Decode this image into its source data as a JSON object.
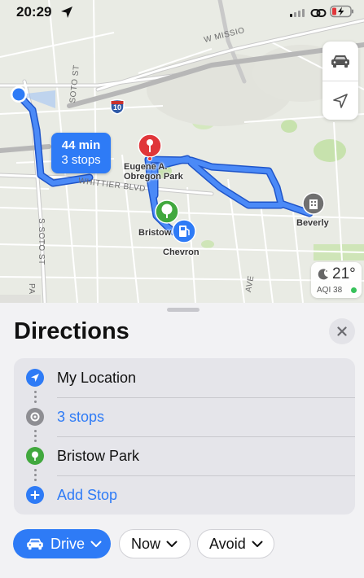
{
  "status_bar": {
    "time": "20:29"
  },
  "map": {
    "route_bubble": {
      "duration": "44 min",
      "stops": "3 stops"
    },
    "street_labels": {
      "w_mission": "W MISSIO",
      "soto_st_top": "SOTO ST",
      "whittier_blvd": "WHITTIER BLVD",
      "s_soto_st": "S SOTO ST",
      "pas": "PA",
      "ave": "AVE"
    },
    "highway_shield": "10",
    "places": {
      "park_name_line1": "Eugene A.",
      "park_name_line2": "Obregon Park",
      "bristow": "Bristow",
      "chevron": "Chevron",
      "beverly": "Beverly"
    },
    "weather": {
      "temperature": "21°",
      "aqi": "AQI 38"
    },
    "colors": {
      "route": "#3d7ff5",
      "pin_red": "#e0363a",
      "pin_green": "#41a83e",
      "pin_blue": "#2e7bf6",
      "pin_gray": "#707070"
    }
  },
  "sheet": {
    "title": "Directions",
    "route": [
      {
        "label": "My Location",
        "icon": "location-arrow-icon",
        "color": "#2e7bf6"
      },
      {
        "label": "3 stops",
        "icon": "stops-icon",
        "color": "#8e8e93"
      },
      {
        "label": "Bristow Park",
        "icon": "tree-icon",
        "color": "#41a83e"
      },
      {
        "label": "Add Stop",
        "icon": "plus-icon",
        "color": "#2e7bf6"
      }
    ],
    "options": {
      "drive": "Drive",
      "now": "Now",
      "avoid": "Avoid"
    }
  }
}
